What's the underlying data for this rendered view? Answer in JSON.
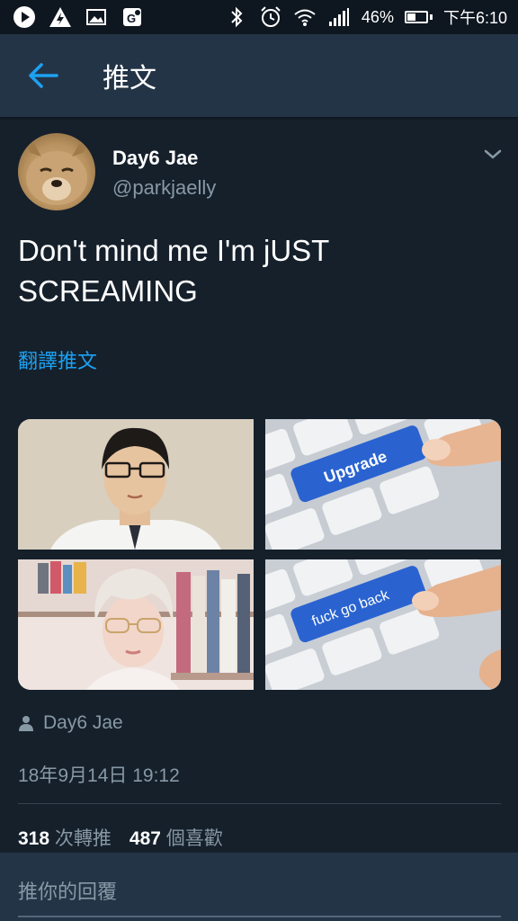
{
  "status_bar": {
    "battery_percent": "46%",
    "time": "下午6:10",
    "battery_level": 0.46
  },
  "app_bar": {
    "title": "推文"
  },
  "tweet": {
    "author_name": "Day6 Jae",
    "author_handle": "@parkjaelly",
    "text_line1": "Don't mind me I'm jUST",
    "text_line2": "SCREAMING",
    "translate_label": "翻譯推文",
    "media": [
      {
        "type": "photo",
        "subject": "portrait"
      },
      {
        "type": "photo",
        "subject": "keyboard",
        "key_label": "Upgrade"
      },
      {
        "type": "photo",
        "subject": "portrait"
      },
      {
        "type": "photo",
        "subject": "keyboard",
        "key_label": "fuck go back"
      }
    ],
    "context_user": "Day6 Jae",
    "timestamp": "18年9月14日 19:12",
    "retweets_count": "318",
    "retweets_label": "次轉推",
    "likes_count": "487",
    "likes_label": "個喜歡"
  },
  "reply": {
    "placeholder": "推你的回覆"
  },
  "colors": {
    "background": "#15202b",
    "app_bar": "#243447",
    "accent": "#1da1f2",
    "secondary_text": "#8899a6",
    "key_blue": "#2a63d0"
  }
}
